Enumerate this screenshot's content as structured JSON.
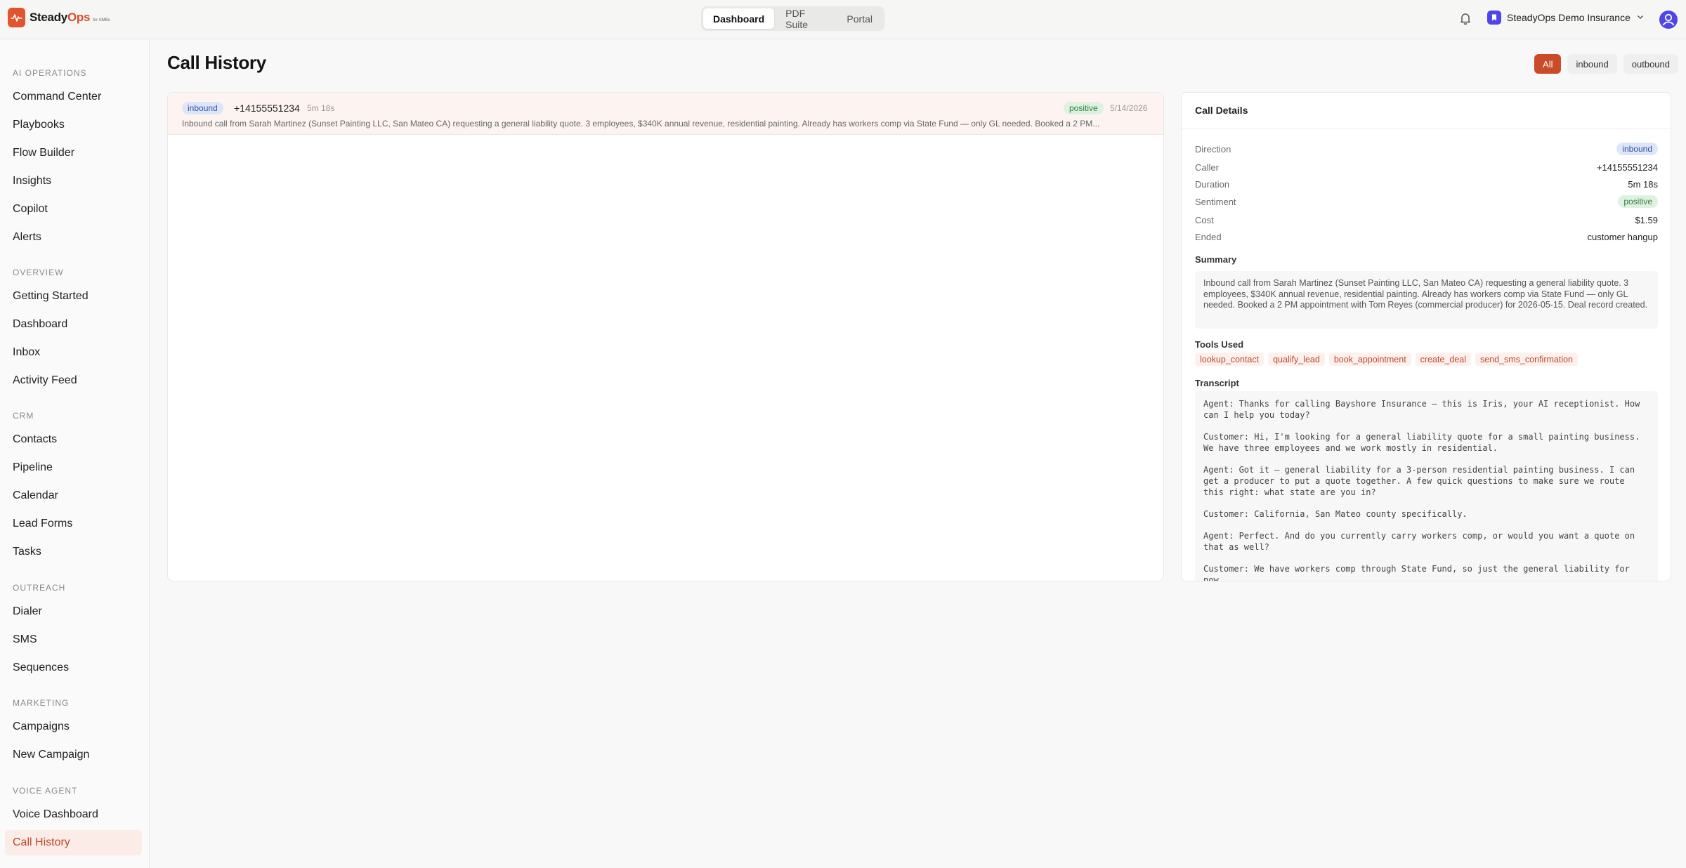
{
  "brand": {
    "name_a": "Steady",
    "name_b": "Ops",
    "tagline": "for SMBs"
  },
  "topnav": {
    "tabs": [
      {
        "label": "Dashboard"
      },
      {
        "label": "PDF Suite"
      },
      {
        "label": "Portal"
      }
    ]
  },
  "org": {
    "name": "SteadyOps Demo Insurance"
  },
  "sidebar": {
    "sections": [
      {
        "title": "AI OPERATIONS",
        "items": [
          "Command Center",
          "Playbooks",
          "Flow Builder",
          "Insights",
          "Copilot",
          "Alerts"
        ]
      },
      {
        "title": "OVERVIEW",
        "items": [
          "Getting Started",
          "Dashboard",
          "Inbox",
          "Activity Feed"
        ]
      },
      {
        "title": "CRM",
        "items": [
          "Contacts",
          "Pipeline",
          "Calendar",
          "Lead Forms",
          "Tasks"
        ]
      },
      {
        "title": "OUTREACH",
        "items": [
          "Dialer",
          "SMS",
          "Sequences"
        ]
      },
      {
        "title": "MARKETING",
        "items": [
          "Campaigns",
          "New Campaign"
        ]
      },
      {
        "title": "VOICE AGENT",
        "items": [
          "Voice Dashboard",
          "Call History"
        ]
      }
    ],
    "active": "Call History"
  },
  "page": {
    "title": "Call History"
  },
  "filters": [
    {
      "label": "All"
    },
    {
      "label": "inbound"
    },
    {
      "label": "outbound"
    }
  ],
  "calls": [
    {
      "direction": "inbound",
      "phone": "+14155551234",
      "duration": "5m 18s",
      "sentiment": "positive",
      "date": "5/14/2026",
      "summary": "Inbound call from Sarah Martinez (Sunset Painting LLC, San Mateo CA) requesting a general liability quote. 3 employees, $340K annual revenue, residential painting. Already has workers comp via State Fund — only GL needed. Booked a 2 PM..."
    }
  ],
  "details": {
    "title": "Call Details",
    "direction_label": "Direction",
    "direction": "inbound",
    "caller_label": "Caller",
    "caller": "+14155551234",
    "duration_label": "Duration",
    "duration": "5m 18s",
    "sentiment_label": "Sentiment",
    "sentiment": "positive",
    "cost_label": "Cost",
    "cost": "$1.59",
    "ended_label": "Ended",
    "ended": "customer hangup",
    "summary_label": "Summary",
    "summary": "Inbound call from Sarah Martinez (Sunset Painting LLC, San Mateo CA) requesting a general liability quote. 3 employees, $340K annual revenue, residential painting. Already has workers comp via State Fund — only GL needed. Booked a 2 PM appointment with Tom Reyes (commercial producer) for 2026-05-15. Deal record created.",
    "tools_label": "Tools Used",
    "tools": [
      "lookup_contact",
      "qualify_lead",
      "book_appointment",
      "create_deal",
      "send_sms_confirmation"
    ],
    "transcript_label": "Transcript",
    "transcript": [
      "Agent: Thanks for calling Bayshore Insurance — this is Iris, your AI receptionist. How can I help you today?",
      "Customer: Hi, I'm looking for a general liability quote for a small painting business. We have three employees and we work mostly in residential.",
      "Agent: Got it — general liability for a 3-person residential painting business. I can get a producer to put a quote together. A few quick questions to make sure we route this right: what state are you in?",
      "Customer: California, San Mateo county specifically.",
      "Agent: Perfect. And do you currently carry workers comp, or would you want a quote on that as well?",
      "Customer: We have workers comp through State Fund, so just the general liability for now."
    ]
  }
}
